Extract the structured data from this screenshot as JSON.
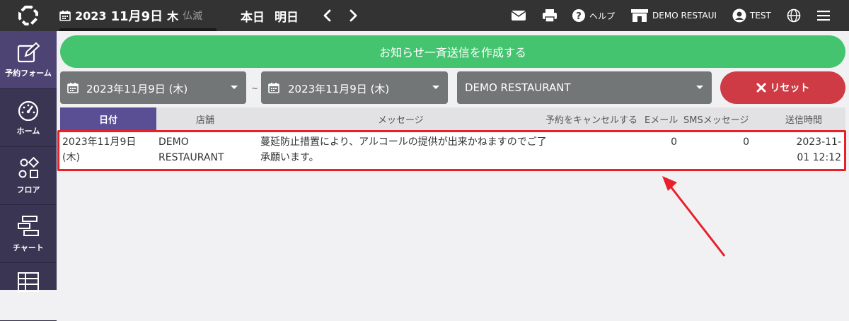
{
  "header": {
    "date_year": "2023",
    "date_main": "11月9日",
    "date_weekday": "木",
    "date_rokuyo": "仏滅",
    "today_label": "本日",
    "tomorrow_label": "明日",
    "help_label": "ヘルプ",
    "restaurant_label": "DEMO RESTAUI",
    "user_label": "TEST"
  },
  "sidebar": {
    "items": [
      {
        "label": "予約フォーム",
        "icon": "edit-icon"
      },
      {
        "label": "ホーム",
        "icon": "dashboard-icon"
      },
      {
        "label": "フロア",
        "icon": "floor-icon"
      },
      {
        "label": "チャート",
        "icon": "chart-icon"
      },
      {
        "label": "",
        "icon": "table-icon"
      }
    ]
  },
  "actions": {
    "create_label": "お知らせ一斉送信を作成する",
    "reset_label": "リセット"
  },
  "filters": {
    "date_from": "2023年11月9日 (木)",
    "date_sep": "~",
    "date_to": "2023年11月9日 (木)",
    "restaurant": "DEMO RESTAURANT"
  },
  "table": {
    "headers": [
      "日付",
      "店舗",
      "メッセージ",
      "予約をキャンセルする",
      "Eメール",
      "SMSメッセージ",
      "送信時間"
    ],
    "rows": [
      {
        "date_l1": "2023年11月9日",
        "date_l2": "(木)",
        "store_l1": "DEMO",
        "store_l2": "RESTAURANT",
        "msg_l1": "蔓延防止措置により、アルコールの提供が出来かねますのでご了",
        "msg_l2": "承願います。",
        "cancel": "",
        "email": "0",
        "sms": "0",
        "time_l1": "2023-11-",
        "time_l2": "01 12:12"
      }
    ]
  },
  "colors": {
    "topbar": "#333333",
    "sidebar": "#3a3553",
    "create_green": "#45c46f",
    "reset_red": "#cf3b44",
    "active_tab": "#5a4f95",
    "highlight": "#e8202a"
  }
}
